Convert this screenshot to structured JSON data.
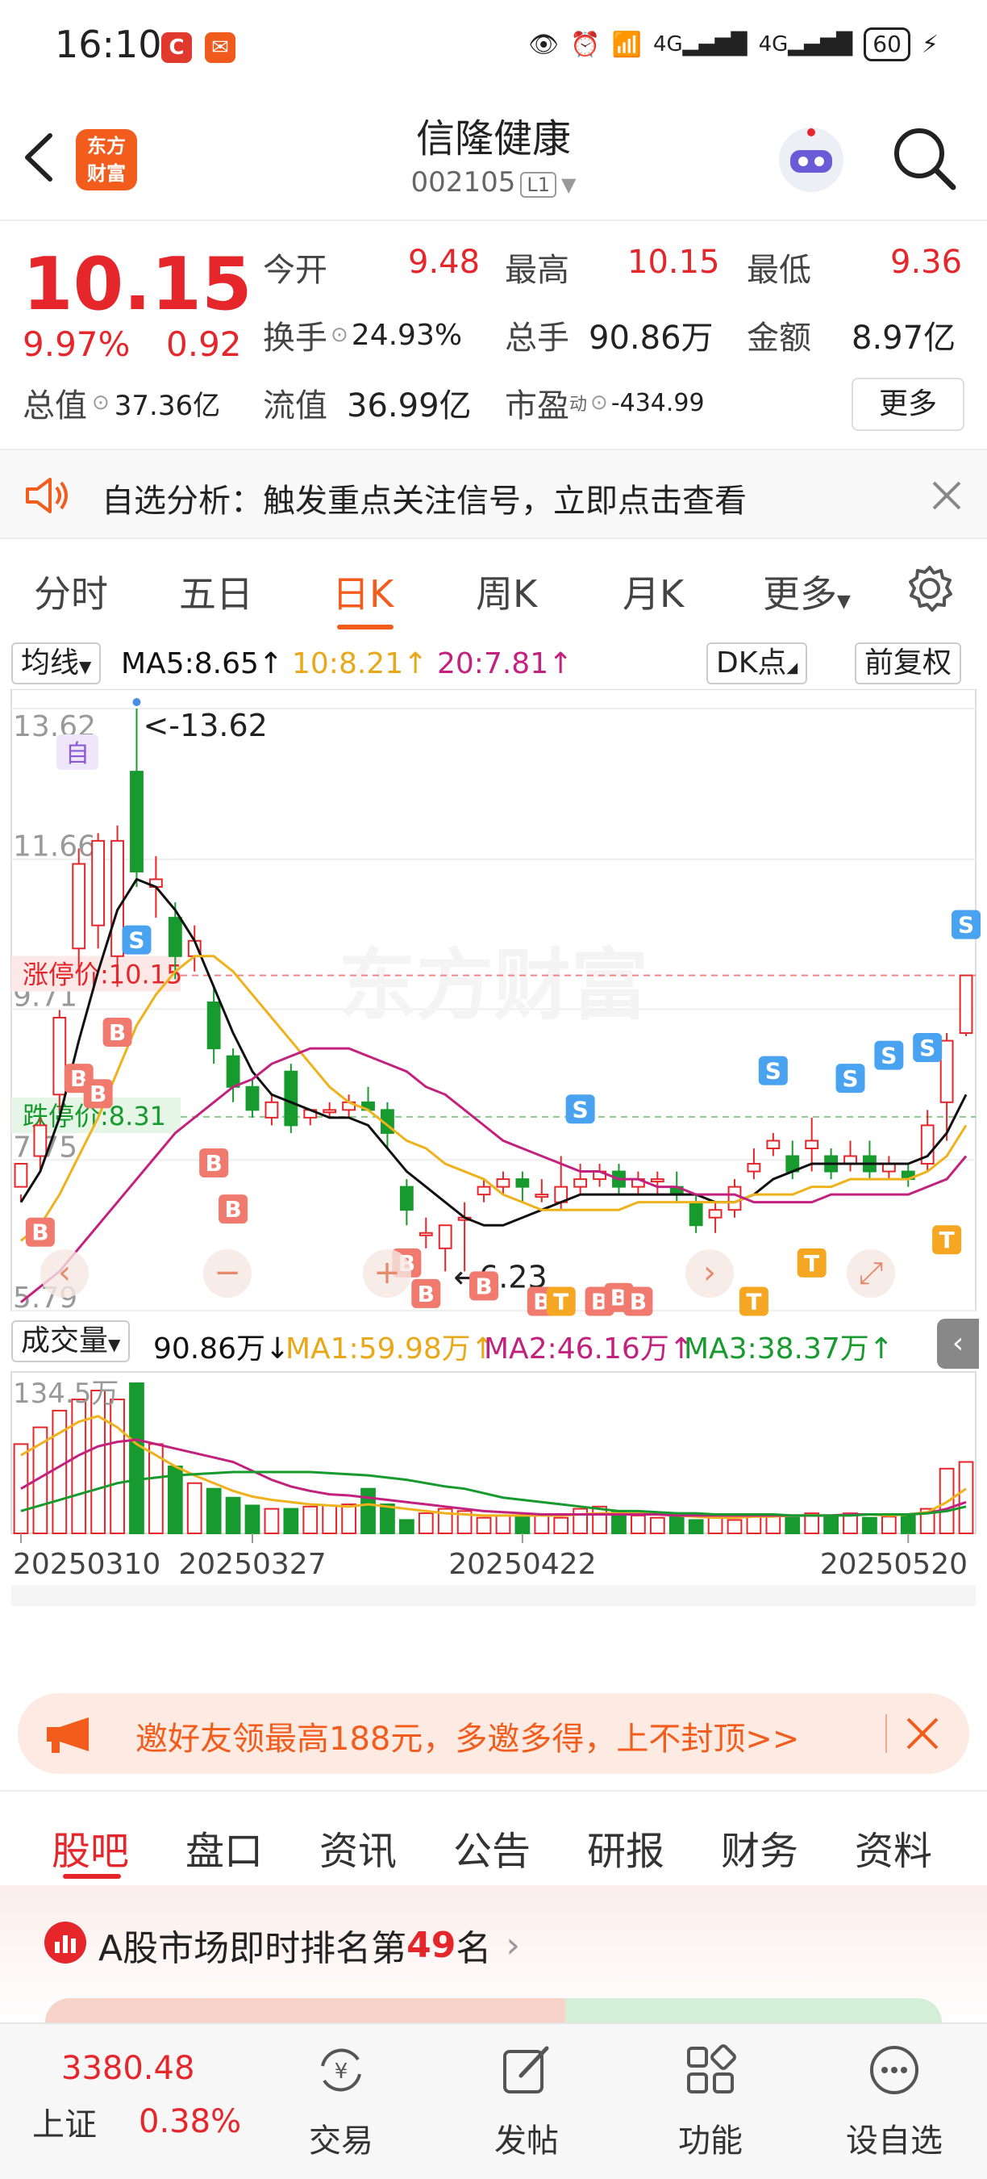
{
  "status_bar": {
    "time": "16:10",
    "battery": "60"
  },
  "header": {
    "logo_text": "东方\n财富",
    "stock_name": "信隆健康",
    "stock_code": "002105",
    "level": "L1"
  },
  "quote": {
    "price": "10.15",
    "change_pct": "9.97%",
    "change": "0.92",
    "open_label": "今开",
    "open": "9.48",
    "high_label": "最高",
    "high": "10.15",
    "low_label": "最低",
    "low": "9.36",
    "turnover_label": "换手",
    "turnover": "24.93%",
    "volume_label": "总手",
    "volume": "90.86万",
    "amount_label": "金额",
    "amount": "8.97亿",
    "mktcap_label": "总值",
    "mktcap": "37.36亿",
    "float_label": "流值",
    "float": "36.99亿",
    "pe_label": "市盈",
    "pe_sup": "动",
    "pe": "-434.99",
    "more": "更多"
  },
  "notice": {
    "text": "自选分析：触发重点关注信号，立即点击查看"
  },
  "tabs": [
    "分时",
    "五日",
    "日K",
    "周K",
    "月K",
    "更多"
  ],
  "kline": {
    "ma_select": "均线",
    "ma5": "MA5:8.65↑",
    "ma10": "10:8.21↑",
    "ma20": "20:7.81↑",
    "dk": "DK点",
    "adjust": "前复权",
    "limit_up_label": "涨停价:10.15",
    "limit_down_label": "跌停价:8.31",
    "max_label": "<-13.62",
    "min_label": "←6.23",
    "self_tag": "自",
    "watermark": "东方财富",
    "colors": {
      "up": "#e5262b",
      "down": "#179a2e",
      "ma5": "#111111",
      "ma10": "#f0b21c",
      "ma20": "#c2227e"
    }
  },
  "volume": {
    "select": "成交量",
    "value": "90.86万↓",
    "ma1": "MA1:59.98万↑",
    "ma2": "MA2:46.16万↑",
    "ma3": "MA3:38.37万↑",
    "max_label": "134.5万"
  },
  "chart_data": {
    "type": "candlestick",
    "yticks": [
      "13.62",
      "11.66",
      "9.71",
      "7.75",
      "5.79"
    ],
    "ylim": [
      5.79,
      13.62
    ],
    "xticks": [
      "20250310",
      "20250327",
      "20250422",
      "20250520"
    ],
    "candles": [
      [
        7.4,
        7.7,
        7.3,
        7.2
      ],
      [
        7.8,
        8.2,
        8.3,
        7.6
      ],
      [
        8.6,
        9.6,
        9.7,
        8.4
      ],
      [
        10.5,
        11.6,
        11.8,
        10.2
      ],
      [
        10.8,
        11.9,
        12.0,
        10.5
      ],
      [
        10.4,
        11.9,
        12.1,
        10.0
      ],
      [
        12.8,
        11.5,
        13.62,
        11.3
      ],
      [
        11.3,
        11.4,
        11.7,
        10.9
      ],
      [
        10.9,
        10.4,
        11.1,
        10.1
      ],
      [
        10.4,
        10.6,
        10.8,
        10.2
      ],
      [
        9.8,
        9.2,
        10.0,
        9.0
      ],
      [
        9.1,
        8.7,
        9.2,
        8.5
      ],
      [
        8.7,
        8.4,
        8.8,
        8.3
      ],
      [
        8.3,
        8.5,
        8.6,
        8.2
      ],
      [
        8.9,
        8.2,
        9.0,
        8.1
      ],
      [
        8.3,
        8.4,
        8.4,
        8.2
      ],
      [
        8.4,
        8.4,
        8.5,
        8.3
      ],
      [
        8.4,
        8.5,
        8.6,
        8.3
      ],
      [
        8.5,
        8.4,
        8.7,
        8.4
      ],
      [
        8.4,
        8.1,
        8.5,
        7.9
      ],
      [
        7.4,
        7.1,
        7.5,
        6.9
      ],
      [
        6.8,
        6.8,
        7.0,
        6.6
      ],
      [
        6.6,
        6.9,
        6.9,
        6.3
      ],
      [
        7.0,
        7.0,
        7.2,
        6.3
      ],
      [
        7.3,
        7.4,
        7.5,
        7.2
      ],
      [
        7.4,
        7.5,
        7.6,
        7.3
      ],
      [
        7.5,
        7.4,
        7.6,
        7.2
      ],
      [
        7.3,
        7.3,
        7.5,
        7.2
      ],
      [
        7.2,
        7.4,
        7.8,
        7.1
      ],
      [
        7.4,
        7.5,
        7.7,
        7.3
      ],
      [
        7.5,
        7.6,
        7.7,
        7.4
      ],
      [
        7.6,
        7.4,
        7.7,
        7.3
      ],
      [
        7.4,
        7.5,
        7.6,
        7.3
      ],
      [
        7.5,
        7.5,
        7.6,
        7.3
      ],
      [
        7.4,
        7.3,
        7.6,
        7.2
      ],
      [
        7.2,
        6.9,
        7.3,
        6.8
      ],
      [
        7.0,
        7.1,
        7.2,
        6.8
      ],
      [
        7.1,
        7.4,
        7.5,
        7.0
      ],
      [
        7.6,
        7.7,
        7.9,
        7.5
      ],
      [
        7.9,
        8.0,
        8.1,
        7.8
      ],
      [
        7.8,
        7.6,
        8.0,
        7.5
      ],
      [
        7.9,
        8.0,
        8.3,
        7.6
      ],
      [
        7.8,
        7.6,
        7.9,
        7.5
      ],
      [
        7.7,
        7.8,
        8.0,
        7.6
      ],
      [
        7.8,
        7.6,
        8.0,
        7.5
      ],
      [
        7.6,
        7.7,
        7.8,
        7.5
      ],
      [
        7.6,
        7.5,
        7.7,
        7.4
      ],
      [
        7.7,
        8.2,
        8.4,
        7.6
      ],
      [
        8.5,
        9.3,
        9.4,
        8.0
      ],
      [
        9.4,
        10.15,
        10.15,
        9.36
      ]
    ],
    "ma5": [
      7.2,
      7.6,
      8.3,
      9.3,
      10.2,
      11.0,
      11.4,
      11.3,
      11.0,
      10.6,
      10.0,
      9.4,
      8.9,
      8.6,
      8.5,
      8.4,
      8.3,
      8.3,
      8.2,
      7.9,
      7.6,
      7.4,
      7.2,
      7.0,
      6.9,
      6.9,
      7.0,
      7.1,
      7.2,
      7.3,
      7.3,
      7.3,
      7.3,
      7.3,
      7.3,
      7.3,
      7.2,
      7.2,
      7.3,
      7.5,
      7.6,
      7.7,
      7.7,
      7.7,
      7.7,
      7.7,
      7.7,
      7.8,
      8.1,
      8.6
    ],
    "ma10": [
      6.7,
      6.9,
      7.3,
      7.8,
      8.3,
      8.9,
      9.5,
      9.9,
      10.2,
      10.4,
      10.4,
      10.2,
      9.9,
      9.6,
      9.3,
      9.0,
      8.7,
      8.5,
      8.4,
      8.2,
      8.0,
      7.9,
      7.7,
      7.6,
      7.5,
      7.3,
      7.2,
      7.1,
      7.1,
      7.1,
      7.1,
      7.1,
      7.2,
      7.2,
      7.2,
      7.2,
      7.2,
      7.2,
      7.3,
      7.3,
      7.3,
      7.4,
      7.4,
      7.5,
      7.5,
      7.5,
      7.5,
      7.6,
      7.8,
      8.2
    ],
    "ma20": [
      5.9,
      6.1,
      6.3,
      6.6,
      6.9,
      7.2,
      7.5,
      7.8,
      8.1,
      8.3,
      8.5,
      8.7,
      8.8,
      9.0,
      9.1,
      9.2,
      9.2,
      9.2,
      9.1,
      9.0,
      8.9,
      8.7,
      8.6,
      8.4,
      8.2,
      8.0,
      7.9,
      7.8,
      7.7,
      7.6,
      7.6,
      7.5,
      7.5,
      7.4,
      7.4,
      7.3,
      7.3,
      7.3,
      7.2,
      7.2,
      7.2,
      7.2,
      7.3,
      7.3,
      7.3,
      7.3,
      7.3,
      7.4,
      7.5,
      7.8
    ],
    "volumes": [
      80,
      95,
      110,
      120,
      128,
      120,
      134.5,
      80,
      60,
      45,
      40,
      32,
      25,
      22,
      22,
      24,
      25,
      26,
      40,
      26,
      12,
      18,
      22,
      20,
      14,
      16,
      15,
      16,
      14,
      22,
      24,
      20,
      16,
      14,
      16,
      12,
      14,
      12,
      16,
      16,
      14,
      18,
      16,
      18,
      14,
      15,
      16,
      22,
      58,
      64
    ],
    "vol_ma1": [
      70,
      80,
      90,
      100,
      105,
      95,
      80,
      70,
      60,
      52,
      45,
      38,
      33,
      30,
      28,
      26,
      25,
      24,
      26,
      24,
      22,
      20,
      18,
      17,
      16,
      16,
      16,
      16,
      16,
      17,
      18,
      18,
      18,
      17,
      16,
      15,
      14,
      14,
      15,
      15,
      16,
      16,
      16,
      17,
      17,
      16,
      17,
      19,
      28,
      40
    ],
    "vol_ma2": [
      40,
      50,
      60,
      70,
      78,
      82,
      84,
      80,
      76,
      72,
      68,
      64,
      56,
      48,
      42,
      38,
      35,
      34,
      32,
      30,
      28,
      26,
      24,
      22,
      20,
      19,
      18,
      17,
      17,
      17,
      17,
      17,
      17,
      17,
      16,
      16,
      16,
      16,
      16,
      16,
      16,
      16,
      16,
      17,
      17,
      17,
      17,
      18,
      22,
      28
    ],
    "vol_ma3": [
      20,
      25,
      30,
      35,
      40,
      45,
      48,
      50,
      52,
      53,
      54,
      55,
      55,
      55,
      55,
      55,
      54,
      53,
      52,
      50,
      48,
      45,
      42,
      40,
      36,
      32,
      30,
      28,
      26,
      24,
      22,
      20,
      20,
      19,
      18,
      18,
      17,
      17,
      17,
      17,
      16,
      16,
      16,
      16,
      17,
      17,
      17,
      18,
      20,
      24
    ]
  },
  "promo": {
    "text": "邀好友领最高188元，多邀多得，上不封顶>>"
  },
  "subtabs": [
    "股吧",
    "盘口",
    "资讯",
    "公告",
    "研报",
    "财务",
    "资料"
  ],
  "rank": {
    "prefix": "A股市场即时排名第",
    "rank": "49",
    "suffix": "名"
  },
  "bottom_nav": {
    "index_value": "3380.48",
    "index_name": "上证",
    "index_change": "0.38%",
    "items": [
      "交易",
      "发帖",
      "功能",
      "设自选"
    ]
  }
}
